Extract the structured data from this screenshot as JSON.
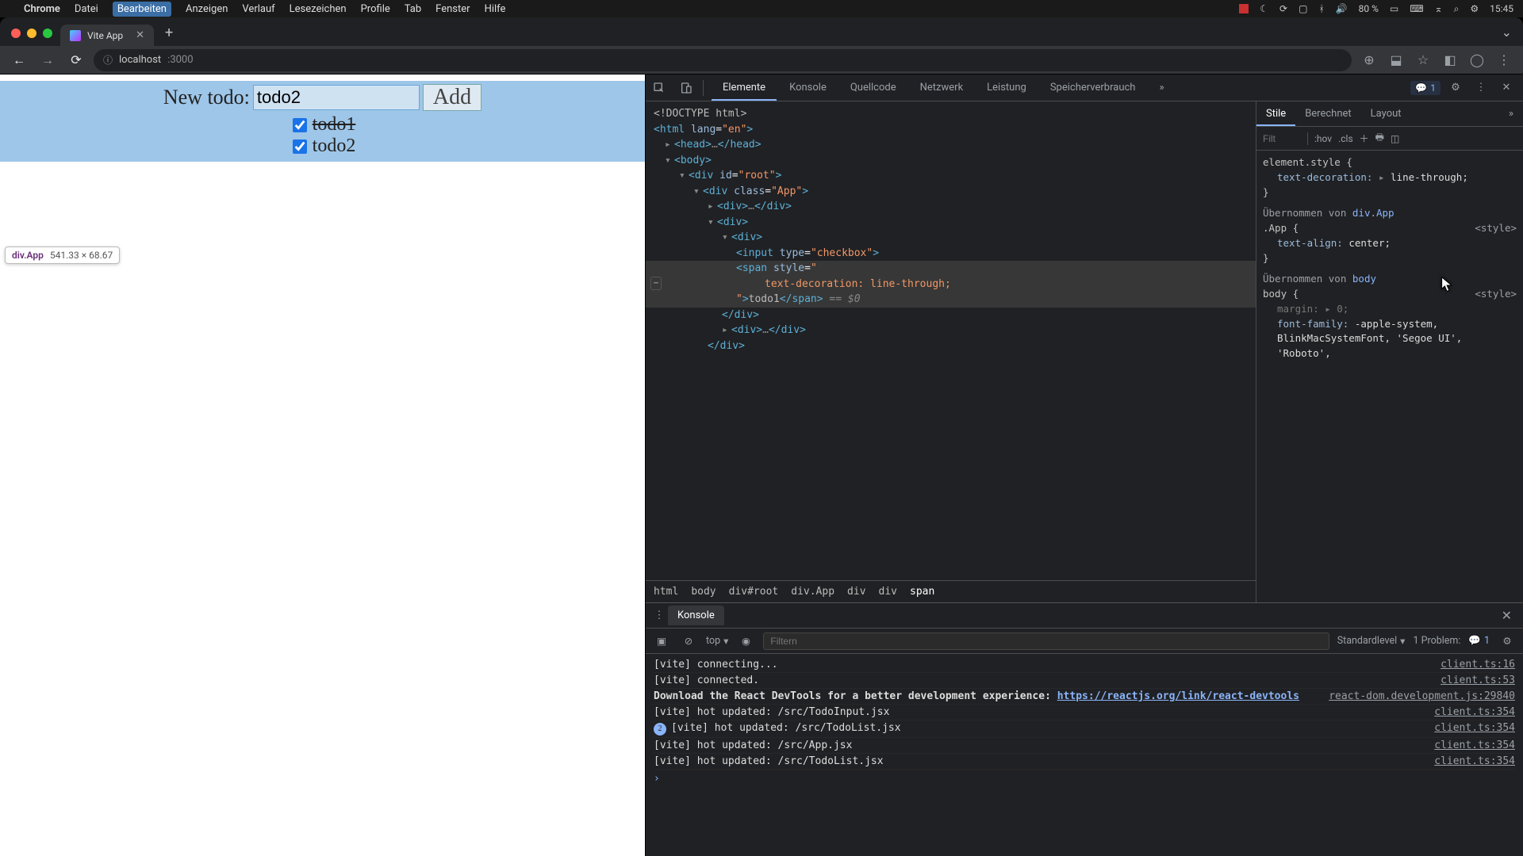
{
  "mac": {
    "app": "Chrome",
    "menus": [
      "Datei",
      "Bearbeiten",
      "Anzeigen",
      "Verlauf",
      "Lesezeichen",
      "Profile",
      "Tab",
      "Fenster",
      "Hilfe"
    ],
    "battery": "80 %",
    "clock": "15:45"
  },
  "browser": {
    "tab_title": "Vite App",
    "url_host": "localhost",
    "url_port": ":3000"
  },
  "page": {
    "label": "New todo:",
    "input_value": "todo2",
    "add_label": "Add",
    "todos": [
      {
        "text": "todo1",
        "checked": true
      },
      {
        "text": "todo2",
        "checked": true
      }
    ],
    "tooltip_selector": "div.App",
    "tooltip_dim": "541.33 × 68.67"
  },
  "devtools": {
    "tabs": [
      "Elemente",
      "Konsole",
      "Quellcode",
      "Netzwerk",
      "Leistung",
      "Speicherverbrauch"
    ],
    "active_tab": "Elemente",
    "issue_count": "1",
    "breadcrumb": [
      "html",
      "body",
      "div#root",
      "div.App",
      "div",
      "div",
      "span"
    ],
    "styles": {
      "tabs": [
        "Stile",
        "Berechnet",
        "Layout"
      ],
      "active": "Stile",
      "filter_placeholder": "Filt",
      "hov": ":hov",
      "cls": ".cls",
      "elem_style_label": "element.style {",
      "elem_style_prop_k": "text-decoration:",
      "elem_style_prop_v": "line-through;",
      "inherit_app": "Übernommen von ",
      "inherit_app_link": "div.App",
      "app_selector": ".App {",
      "app_prop_k": "text-align:",
      "app_prop_v": "center;",
      "inherit_body": "Übernommen von ",
      "inherit_body_link": "body",
      "body_selector": "body {",
      "body_margin_k": "margin:",
      "body_margin_v": "0;",
      "body_ff_k": "font-family:",
      "body_ff_v": "-apple-system, BlinkMacSystemFont, 'Segoe UI', 'Roboto',",
      "style_src": "<style>"
    },
    "dom_lines": {
      "doctype": "<!DOCTYPE html>",
      "html_open": "<html lang=\"en\">",
      "head": "<head>…</head>",
      "body_open": "<body>",
      "root_open": "<div id=\"root\">",
      "app_open": "<div class=\"App\">",
      "div1": "<div>…</div>",
      "div2_open": "<div>",
      "div3_open": "<div>",
      "input": "<input type=\"checkbox\">",
      "span_open": "<span style=\"",
      "span_css": "text-decoration: line-through;",
      "span_close": "\">todo1</span>",
      "eq0": " == $0",
      "div3_close": "</div>",
      "div4": "<div>…</div>",
      "div2_close": "</div>"
    },
    "console": {
      "tab": "Konsole",
      "context": "top",
      "filter_placeholder": "Filtern",
      "level": "Standardlevel",
      "problems_label": "1 Problem:",
      "problems_count": "1",
      "logs": [
        {
          "msg": "[vite] connecting...",
          "src": "client.ts:16"
        },
        {
          "msg": "[vite] connected.",
          "src": "client.ts:53"
        },
        {
          "msg": "Download the React DevTools for a better development experience: ",
          "url": "https://reactjs.org/link/react-devtools",
          "src": "react-dom.development.js:29840",
          "bold": true
        },
        {
          "msg": "[vite] hot updated: /src/TodoInput.jsx",
          "src": "client.ts:354"
        },
        {
          "badge": "2",
          "msg": "[vite] hot updated: /src/TodoList.jsx",
          "src": "client.ts:354"
        },
        {
          "msg": "[vite] hot updated: /src/App.jsx",
          "src": "client.ts:354"
        },
        {
          "msg": "[vite] hot updated: /src/TodoList.jsx",
          "src": "client.ts:354"
        }
      ]
    }
  }
}
